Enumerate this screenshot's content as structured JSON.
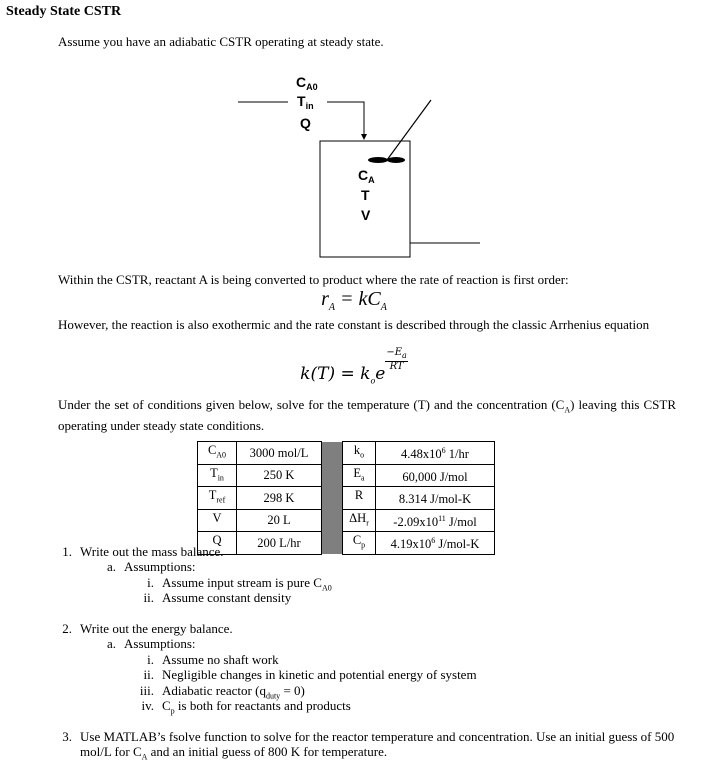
{
  "title": "Steady State CSTR",
  "intro": "Assume you have an adiabatic CSTR operating at steady state.",
  "diagram": {
    "inlet_labels": [
      "C",
      "T",
      "Q"
    ],
    "inlet_subs": [
      "A0",
      "in",
      ""
    ],
    "reactor_labels": [
      "C",
      "T",
      "V"
    ],
    "reactor_subs": [
      "A",
      "",
      ""
    ]
  },
  "paragraph_reaction": "Within the CSTR, reactant A is being converted to product where the rate of reaction is first order:",
  "equation_rate": {
    "lhs": "r",
    "lhs_sub": "A",
    "rhs": "= kC",
    "rhs_sub": "A"
  },
  "paragraph_arrhenius": "However, the reaction is also exothermic and the rate constant is described through the classic Arrhenius equation",
  "equation_arrhenius": {
    "lhs": "k(T) = ",
    "base": "k",
    "base_sub": "o",
    "e": "e",
    "num": "−E",
    "num_sub": "a",
    "den": "RT"
  },
  "paragraph_solve": "Under the set of conditions given below, solve for the temperature (T) and the concentration (C",
  "paragraph_solve_sub": "A",
  "paragraph_solve_end": ") leaving this CSTR operating under steady state conditions.",
  "parameters": [
    {
      "sym": "C",
      "sym_sub": "A0",
      "val": "3000 mol/L",
      "sym2": "k",
      "sym2_sub": "o",
      "val2": "4.48x10",
      "val2_sup": "6",
      "val2_unit": " 1/hr"
    },
    {
      "sym": "T",
      "sym_sub": "in",
      "val": "250 K",
      "sym2": "E",
      "sym2_sub": "a",
      "val2": "60,000 J/mol",
      "val2_sup": "",
      "val2_unit": ""
    },
    {
      "sym": "T",
      "sym_sub": "ref",
      "val": "298 K",
      "sym2": "R",
      "sym2_sub": "",
      "val2": "8.314 J/mol-K",
      "val2_sup": "",
      "val2_unit": ""
    },
    {
      "sym": "V",
      "sym_sub": "",
      "val": "20 L",
      "sym2": "ΔH",
      "sym2_sub": "r",
      "val2": "-2.09x10",
      "val2_sup": "11",
      "val2_unit": " J/mol"
    },
    {
      "sym": "Q",
      "sym_sub": "",
      "val": "200 L/hr",
      "sym2": "C",
      "sym2_sub": "p",
      "val2": "4.19x10",
      "val2_sup": "6",
      "val2_unit": " J/mol-K"
    }
  ],
  "questions": {
    "q1": {
      "num": "1.",
      "text": "Write out the mass balance.",
      "a": {
        "num": "a.",
        "text": "Assumptions:"
      },
      "i": {
        "num": "i.",
        "text": "Assume input stream is pure C",
        "sub": "A0"
      },
      "ii": {
        "num": "ii.",
        "text": "Assume constant density"
      }
    },
    "q2": {
      "num": "2.",
      "text": "Write out the energy balance.",
      "a": {
        "num": "a.",
        "text": "Assumptions:"
      },
      "i": {
        "num": "i.",
        "text": "Assume no shaft work"
      },
      "ii": {
        "num": "ii.",
        "text": "Negligible changes in kinetic and potential energy of system"
      },
      "iii": {
        "num": "iii.",
        "text": "Adiabatic reactor (q",
        "sub": "duty",
        "end": " = 0)"
      },
      "iv": {
        "num": "iv.",
        "text": "C",
        "sub": "p",
        "end": " is both for reactants and products"
      }
    },
    "q3": {
      "num": "3.",
      "text": "Use MATLAB’s fsolve function to solve for the reactor temperature and concentration. Use an initial guess of 500 mol/L for C",
      "sub": "A",
      "end": " and an initial guess of 800 K for temperature."
    }
  }
}
